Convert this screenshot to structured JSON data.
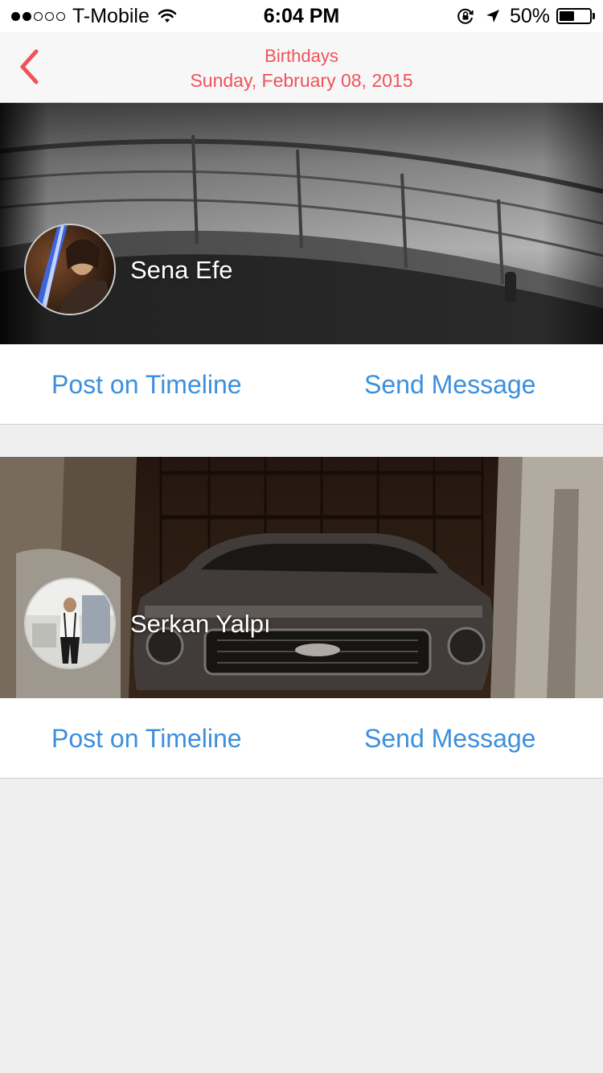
{
  "status_bar": {
    "signal_bars_filled": 2,
    "signal_bars_total": 5,
    "carrier": "T-Mobile",
    "time": "6:04 PM",
    "battery_percent_label": "50%",
    "battery_level": 0.5,
    "icons": [
      "wifi-icon",
      "rotation-lock-icon",
      "location-arrow-icon",
      "battery-icon"
    ]
  },
  "nav": {
    "back_icon": "chevron-left-icon",
    "title": "Birthdays",
    "subtitle": "Sunday, February 08, 2015",
    "accent_color": "#f0525a"
  },
  "people": [
    {
      "name": "Sena Efe",
      "post_label": "Post on Timeline",
      "message_label": "Send Message"
    },
    {
      "name": "Serkan Yalpı",
      "post_label": "Post on Timeline",
      "message_label": "Send Message"
    }
  ],
  "colors": {
    "link": "#3d8fdc",
    "background": "#efefef"
  }
}
